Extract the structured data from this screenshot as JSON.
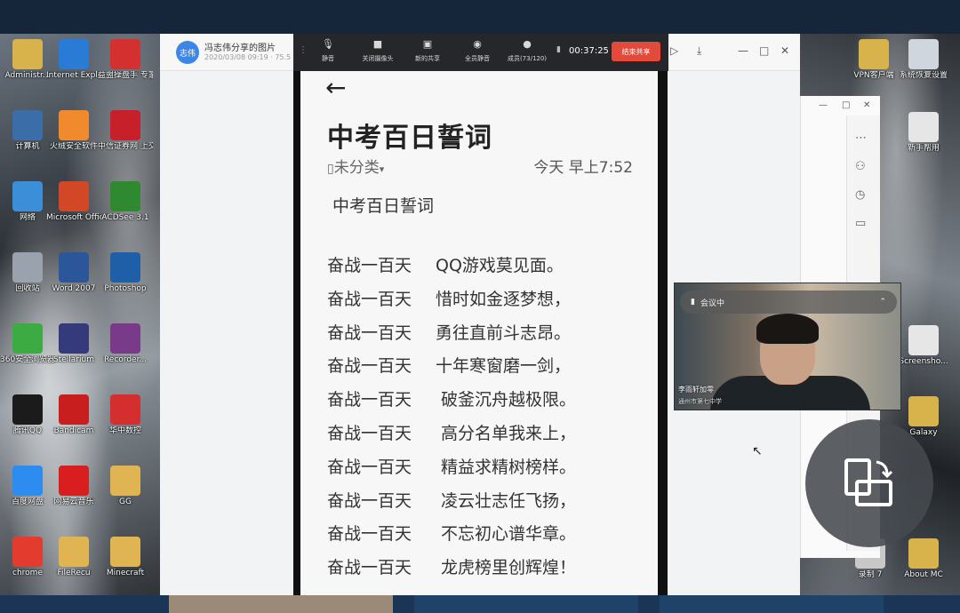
{
  "desktop_left": {
    "icons": [
      {
        "label": "Administr...",
        "icon": "folder-icon",
        "color": "#d8b24a"
      },
      {
        "label": "Internet Explorer",
        "icon": "ie-icon",
        "color": "#2a7bd6"
      },
      {
        "label": "益盟操盘手 专家",
        "icon": "app-icon",
        "color": "#d43030"
      },
      {
        "label": "计算机",
        "icon": "computer-icon",
        "color": "#3b6ea8"
      },
      {
        "label": "火绒安全软件",
        "icon": "shield-icon",
        "color": "#f08a2c"
      },
      {
        "label": "中信证券网 上交易极...",
        "icon": "app-icon",
        "color": "#c8202a"
      },
      {
        "label": "网络",
        "icon": "network-icon",
        "color": "#3a8fd8"
      },
      {
        "label": "Microsoft Office Po...",
        "icon": "ppt-icon",
        "color": "#d24726"
      },
      {
        "label": "ACDSee 3.1",
        "icon": "eye-icon",
        "color": "#2f8a2f"
      },
      {
        "label": "回收站",
        "icon": "trash-icon",
        "color": "#9aa3ad"
      },
      {
        "label": "Word 2007",
        "icon": "word-icon",
        "color": "#2b579a"
      },
      {
        "label": "Photoshop",
        "icon": "ps-icon",
        "color": "#1f5fa8"
      },
      {
        "label": "360安全浏览器",
        "icon": "browser-icon",
        "color": "#3dab43"
      },
      {
        "label": "Stellarium",
        "icon": "moon-icon",
        "color": "#343a7a"
      },
      {
        "label": "Recorder...",
        "icon": "archive-icon",
        "color": "#7a3a8a"
      },
      {
        "label": "腾讯QQ",
        "icon": "qq-icon",
        "color": "#1b1b1b"
      },
      {
        "label": "Bandicam",
        "icon": "record-icon",
        "color": "#c81e1e"
      },
      {
        "label": "华中数控",
        "icon": "app-icon",
        "color": "#d42e2e"
      },
      {
        "label": "百度网盘",
        "icon": "cloud-icon",
        "color": "#2d8cf0"
      },
      {
        "label": "网易云音乐",
        "icon": "music-icon",
        "color": "#d81e1e"
      },
      {
        "label": "GG",
        "icon": "folder-icon",
        "color": "#e0b450"
      },
      {
        "label": "chrome",
        "icon": "chrome-icon",
        "color": "#e33b2e"
      },
      {
        "label": "FileRecu",
        "icon": "folder-icon",
        "color": "#e0b450"
      },
      {
        "label": "Minecraft",
        "icon": "folder-icon",
        "color": "#e0b450"
      }
    ]
  },
  "desktop_right": {
    "icons": [
      {
        "label": "VPN客户端",
        "icon": "folder-icon",
        "color": "#d8b24a"
      },
      {
        "label": "系统恢复设置",
        "icon": "doc-icon",
        "color": "#cfd6dd"
      },
      {
        "label": "新手帮用",
        "icon": "doc-icon",
        "color": "#e6e6e6"
      },
      {
        "label": "Screensho...",
        "icon": "doc-icon",
        "color": "#e6e6e6"
      },
      {
        "label": "Galaxy",
        "icon": "folder-icon",
        "color": "#d8b24a"
      },
      {
        "label": "录制 7",
        "icon": "app-icon",
        "color": "#c8c8c8"
      },
      {
        "label": "About MC",
        "icon": "folder-icon",
        "color": "#d8b24a"
      }
    ]
  },
  "meeting": {
    "avatar_text": "志伟",
    "share_title": "冯志伟分享的图片",
    "share_time": "2020/03/08 09:19 · 75.5",
    "toolbar": {
      "items": [
        {
          "label": "静音",
          "icon": "mic-icon"
        },
        {
          "label": "关闭摄像头",
          "icon": "camera-icon"
        },
        {
          "label": "新的共享",
          "icon": "share-screen-icon"
        },
        {
          "label": "全员静音",
          "icon": "mute-all-icon"
        },
        {
          "label": "成员(73/120)",
          "icon": "members-icon"
        }
      ],
      "timer": "00:37:25",
      "end_share": "结束共享"
    }
  },
  "note": {
    "title": "中考百日誓词",
    "category": "未分类",
    "time": "今天 早上7:52",
    "body_title": "中考百日誓词",
    "lines": [
      {
        "a": "奋战一百天",
        "b": "QQ游戏莫见面。"
      },
      {
        "a": "奋战一百天",
        "b": "惜时如金逐梦想，"
      },
      {
        "a": "奋战一百天",
        "b": "勇往直前斗志昂。"
      },
      {
        "a": "奋战一百天",
        "b": "十年寒窗磨一剑，"
      },
      {
        "a": "奋战一百天",
        "b": " 破釜沉舟越极限。"
      },
      {
        "a": "奋战一百天",
        "b": " 高分名单我来上，"
      },
      {
        "a": "奋战一百天",
        "b": " 精益求精树榜样。"
      },
      {
        "a": "奋战一百天",
        "b": " 凌云壮志任飞扬，"
      },
      {
        "a": "奋战一百天",
        "b": " 不忘初心谱华章。"
      },
      {
        "a": "奋战一百天",
        "b": " 龙虎榜里创辉煌！"
      }
    ]
  },
  "video_tile": {
    "status": "会议中",
    "name": "李雨轩加零",
    "sub": "通州市第七中学"
  }
}
